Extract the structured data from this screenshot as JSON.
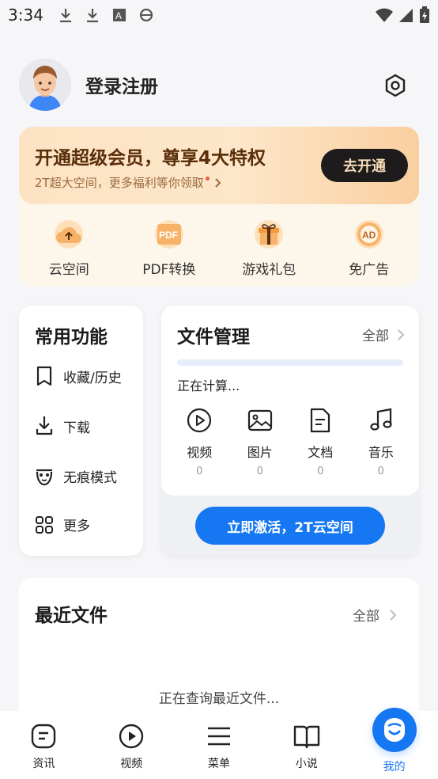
{
  "status": {
    "time": "3:34"
  },
  "profile": {
    "login_label": "登录注册"
  },
  "vip": {
    "title": "开通超级会员，尊享4大特权",
    "subtitle": "2T超大空间，更多福利等你领取",
    "button": "去开通",
    "items": [
      {
        "label": "云空间",
        "icon": "cloud-upload-icon"
      },
      {
        "label": "PDF转换",
        "icon": "pdf-icon"
      },
      {
        "label": "游戏礼包",
        "icon": "gift-icon"
      },
      {
        "label": "免广告",
        "icon": "ad-icon"
      }
    ]
  },
  "common": {
    "title": "常用功能",
    "items": [
      {
        "label": "收藏/历史",
        "icon": "bookmark-icon"
      },
      {
        "label": "下载",
        "icon": "download-icon"
      },
      {
        "label": "无痕模式",
        "icon": "incognito-icon"
      },
      {
        "label": "更多",
        "icon": "grid-icon"
      }
    ]
  },
  "files": {
    "title": "文件管理",
    "all": "全部",
    "status": "正在计算...",
    "types": [
      {
        "label": "视频",
        "count": "0",
        "icon": "video-icon"
      },
      {
        "label": "图片",
        "count": "0",
        "icon": "image-icon"
      },
      {
        "label": "文档",
        "count": "0",
        "icon": "document-icon"
      },
      {
        "label": "音乐",
        "count": "0",
        "icon": "music-icon"
      }
    ],
    "activate_button": "立即激活，2T云空间"
  },
  "recent": {
    "title": "最近文件",
    "all": "全部",
    "status": "正在查询最近文件..."
  },
  "tabs": [
    {
      "label": "资讯",
      "icon": "news-icon"
    },
    {
      "label": "视频",
      "icon": "video-play-icon"
    },
    {
      "label": "菜单",
      "icon": "menu-icon"
    },
    {
      "label": "小说",
      "icon": "book-icon"
    },
    {
      "label": "我的",
      "icon": "me-icon"
    }
  ],
  "colors": {
    "accent": "#1677f2",
    "vip_dark": "#1d1b1b"
  }
}
